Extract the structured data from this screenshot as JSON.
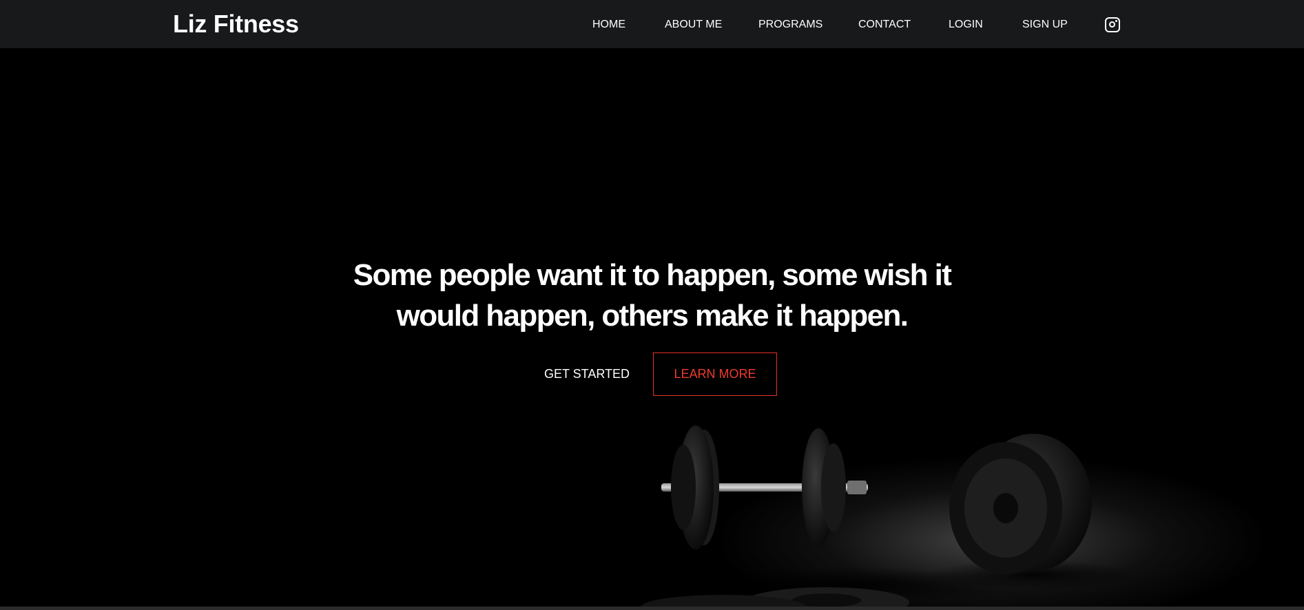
{
  "brand": {
    "name": "Liz Fitness"
  },
  "nav": {
    "items": [
      {
        "label": "HOME"
      },
      {
        "label": "ABOUT ME"
      },
      {
        "label": "PROGRAMS"
      },
      {
        "label": "CONTACT"
      },
      {
        "label": "LOGIN"
      },
      {
        "label": "SIGN UP"
      }
    ],
    "social_icon": "instagram-icon"
  },
  "hero": {
    "headline_line1": "Some people want it to happen, some wish it",
    "headline_line2": "would happen, others make it happen.",
    "primary_button": "GET STARTED",
    "secondary_button": "LEARN MORE",
    "image": "dumbbells-on-floor"
  },
  "colors": {
    "navbar_bg": "#17191b",
    "hero_bg": "#000000",
    "accent": "#e7312a",
    "text": "#ffffff"
  }
}
